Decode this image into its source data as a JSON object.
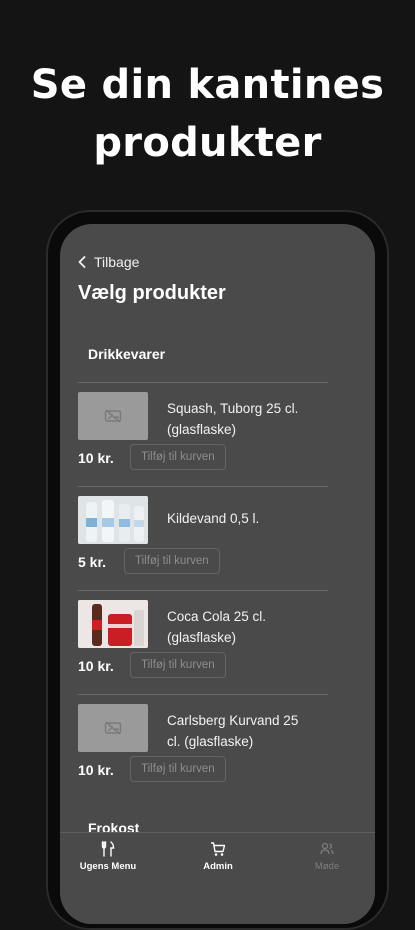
{
  "headline": {
    "line1": "Se din kantines",
    "line2": "produkter"
  },
  "nav": {
    "back_label": "Tilbage"
  },
  "page": {
    "title": "Vælg produkter"
  },
  "sections": [
    {
      "label": "Drikkevarer"
    },
    {
      "label": "Frokost"
    }
  ],
  "products": [
    {
      "name": "Squash, Tuborg 25 cl. (glasflaske)",
      "price": "10 kr.",
      "button": "Tilføj til kurven",
      "image": "image-placeholder-icon"
    },
    {
      "name": "Kildevand 0,5 l.",
      "price": "5 kr.",
      "button": "Tilføj til kurven",
      "image": "water-bottles-photo"
    },
    {
      "name": "Coca Cola 25 cl. (glasflaske)",
      "price": "10 kr.",
      "button": "Tilføj til kurven",
      "image": "coca-cola-photo"
    },
    {
      "name": "Carlsberg Kurvand 25 cl. (glasflaske)",
      "price": "10 kr.",
      "button": "Tilføj til kurven",
      "image": "image-placeholder-icon"
    }
  ],
  "tabbar": {
    "tabs": [
      {
        "label": "Ugens Menu",
        "icon": "cutlery-icon"
      },
      {
        "label": "Admin",
        "icon": "cart-icon"
      },
      {
        "label": "Møde",
        "icon": "meeting-icon"
      }
    ]
  },
  "colors": {
    "background": "#141414",
    "screen": "#4a4a4a",
    "button_text": "#8d8d8d"
  }
}
